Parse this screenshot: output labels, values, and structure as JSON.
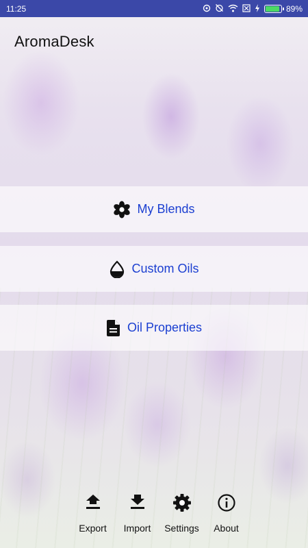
{
  "status_bar": {
    "time": "11:25",
    "battery_percent": "89%",
    "battery_level": 0.89,
    "icons": [
      "sync-icon",
      "alarm-off-icon",
      "wifi-icon",
      "sim-off-icon",
      "charging-icon",
      "battery-icon"
    ]
  },
  "app": {
    "title": "AromaDesk"
  },
  "menu": [
    {
      "label": "My Blends",
      "icon": "flower-icon"
    },
    {
      "label": "Custom Oils",
      "icon": "drop-icon"
    },
    {
      "label": "Oil Properties",
      "icon": "document-icon"
    }
  ],
  "bottom_nav": [
    {
      "label": "Export",
      "icon": "upload-icon"
    },
    {
      "label": "Import",
      "icon": "download-icon"
    },
    {
      "label": "Settings",
      "icon": "gear-icon"
    },
    {
      "label": "About",
      "icon": "info-icon"
    }
  ],
  "colors": {
    "status_bar": "#3b48a8",
    "link_text": "#1b3fd1",
    "battery_fill": "#4cd964"
  }
}
